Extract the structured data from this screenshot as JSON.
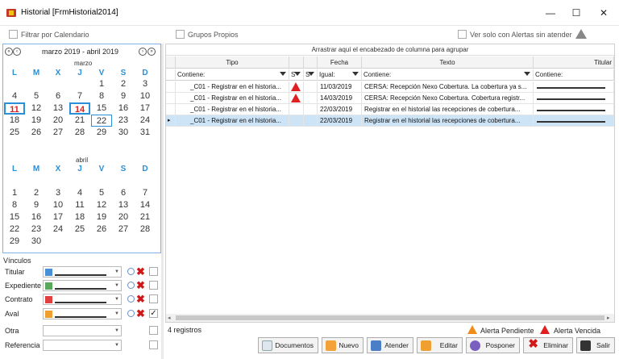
{
  "window": {
    "title": "Historial [FrmHistorial2014]",
    "min": "—",
    "max": "☐",
    "close": "✕"
  },
  "filters": {
    "calendar_label": "Filtrar por Calendario",
    "own_groups_label": "Grupos Propios",
    "alerts_only_label": "Ver solo con Alertas sin atender"
  },
  "calendar": {
    "range_label": "marzo 2019 - abril 2019",
    "dow": [
      "L",
      "M",
      "X",
      "J",
      "V",
      "S",
      "D"
    ],
    "months": [
      {
        "name": "marzo",
        "weeks": [
          [
            "",
            "",
            "",
            "",
            "1",
            "2",
            "3"
          ],
          [
            "4",
            "5",
            "6",
            "7",
            "8",
            "9",
            "10"
          ],
          [
            "11",
            "12",
            "13",
            "14",
            "15",
            "16",
            "17"
          ],
          [
            "18",
            "19",
            "20",
            "21",
            "22",
            "23",
            "24"
          ],
          [
            "25",
            "26",
            "27",
            "28",
            "29",
            "30",
            "31"
          ]
        ]
      },
      {
        "name": "abril",
        "weeks": [
          [
            "1",
            "2",
            "3",
            "4",
            "5",
            "6",
            "7"
          ],
          [
            "8",
            "9",
            "10",
            "11",
            "12",
            "13",
            "14"
          ],
          [
            "15",
            "16",
            "17",
            "18",
            "19",
            "20",
            "21"
          ],
          [
            "22",
            "23",
            "24",
            "25",
            "26",
            "27",
            "28"
          ],
          [
            "29",
            "30",
            "",
            "",
            "",
            "",
            ""
          ]
        ]
      }
    ]
  },
  "vinculos": {
    "title": "Vínculos",
    "rows": [
      {
        "label": "Titular"
      },
      {
        "label": "Expediente"
      },
      {
        "label": "Contrato"
      },
      {
        "label": "Aval"
      },
      {
        "label": "Otra"
      },
      {
        "label": "Referencia"
      }
    ]
  },
  "grid": {
    "group_hint": "Arrastrar aquí el encabezado de columna para agrupar",
    "columns": {
      "tipo": "Tipo",
      "fecha": "Fecha",
      "texto": "Texto",
      "titular": "Titular"
    },
    "filter_row": {
      "tipo": "Contiene:",
      "s1": "S",
      "s2": "S",
      "fecha": "Igual:",
      "texto": "Contiene:",
      "titular": "Contiene:"
    },
    "rows": [
      {
        "tipo": "_C01 - Registrar en el historia...",
        "fecha": "11/03/2019",
        "texto": "CERSA: Recepción Nexo Cobertura. La cobertura ya s..."
      },
      {
        "tipo": "_C01 - Registrar en el historia...",
        "fecha": "14/03/2019",
        "texto": "CERSA: Recepción Nexo Cobertura. Cobertura registr..."
      },
      {
        "tipo": "_C01 - Registrar en el historia...",
        "fecha": "22/03/2019",
        "texto": "Registrar en el historial las recepciones de cobertura..."
      },
      {
        "tipo": "_C01 - Registrar en el historia...",
        "fecha": "22/03/2019",
        "texto": "Registrar en el historial las recepciones de cobertura..."
      }
    ],
    "row_marker": "▸"
  },
  "footer": {
    "count": "4 registros",
    "legend_pending": "Alerta Pendiente",
    "legend_expired": "Alerta Vencida"
  },
  "buttons": {
    "documentos": "Documentos",
    "nuevo": "Nuevo",
    "atender": "Atender",
    "editar": "Editar",
    "posponer": "Posponer",
    "eliminar": "Eliminar",
    "salir": "Salir"
  },
  "colors": {
    "accent": "#2a8fd6",
    "alert_pending": "#f08c1a",
    "alert_expired": "#e02020",
    "selected_row": "#cde4f7"
  }
}
